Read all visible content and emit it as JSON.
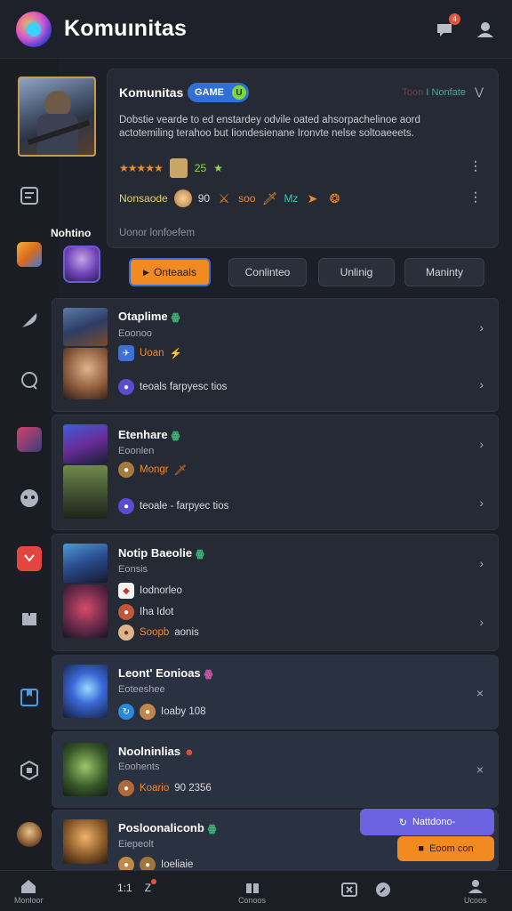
{
  "header": {
    "title": "Komuınitas",
    "notification_count": "4",
    "icons": [
      "app-logo",
      "chat-bubble-icon",
      "user-icon"
    ]
  },
  "rail": {
    "icons": [
      "list-icon",
      "game-tile-icon",
      "feather-icon",
      "chat-icon",
      "game-thumb-icon",
      "ghost-icon",
      "shield-icon",
      "puzzle-icon",
      "bookmark-icon",
      "box-icon",
      "profile-avatar"
    ]
  },
  "card": {
    "title": "Komunitas",
    "badge": "GAME",
    "badge_dot": "U",
    "meta_a": "Toon",
    "meta_sep": "I",
    "meta_b": "Nonfate",
    "collapse": "⋁",
    "description": "Dobstie vearde to ed enstardey odvile oated ahsorpachelinoe aord actotemiling terahoo but Iiondesienane Ironvte nelse soltoaeeets.",
    "stars": "★★★★★",
    "rating": "25",
    "stats_label": "Nonsaode",
    "stats_count": "90",
    "stats_mid": "soo",
    "stats_tail": "Mz",
    "footer": "Uonor lonfoefem"
  },
  "side": {
    "label": "Nohtino"
  },
  "tabs": [
    {
      "label": "Onteaals",
      "active": true
    },
    {
      "label": "Conlinteo",
      "active": false
    },
    {
      "label": "Unlinig",
      "active": false
    },
    {
      "label": "Maninty",
      "active": false
    }
  ],
  "groups": [
    {
      "title": "Otaplime",
      "tag": "ꙮ",
      "sub": "Eoonoo",
      "line1": "Uoan",
      "line1_ico": "⚡",
      "line2": "teoals  farpyesc tios"
    },
    {
      "title": "Etenhare",
      "tag": "ꙮ",
      "sub": "Eoonlen",
      "line1": "Mongr",
      "line1_ico": "🗡",
      "line2": "teoale - farpyec tios"
    },
    {
      "title": "Notip Baeolie",
      "tag": "ꙮ",
      "sub": "Eonsis",
      "line1": "Iodnorleo",
      "line2": "Iha Idot",
      "line3": "Soopb",
      "line3_tail": "aonis"
    },
    {
      "title": "Leont' Eonioas",
      "tag": "ꙮ",
      "sub": "Eoteeshee",
      "line1": "Ioaby 108",
      "chev": "×"
    },
    {
      "title": "Noolninlias",
      "tag": "☻",
      "sub": "Eoohents",
      "line1": "Koario",
      "line1_tail": "90 2356",
      "chev": "×"
    },
    {
      "title": "Posloonaliconb",
      "tag": "ꙮ",
      "sub": "Eiepeolt",
      "line1": "Ioeliaie"
    }
  ],
  "actions": {
    "primary": "Nattdono-",
    "secondary": "Eoom con"
  },
  "bottom_nav": [
    {
      "label": "Monloor"
    },
    {
      "label": "1:1"
    },
    {
      "label": "Conoos"
    },
    {
      "label": ""
    },
    {
      "label": "Ucoos"
    }
  ],
  "colors": {
    "accent_orange": "#f28a22",
    "accent_purple": "#6b63e0",
    "accent_blue": "#2f6fd6",
    "background": "#1c1f27",
    "surface": "#262a34"
  }
}
